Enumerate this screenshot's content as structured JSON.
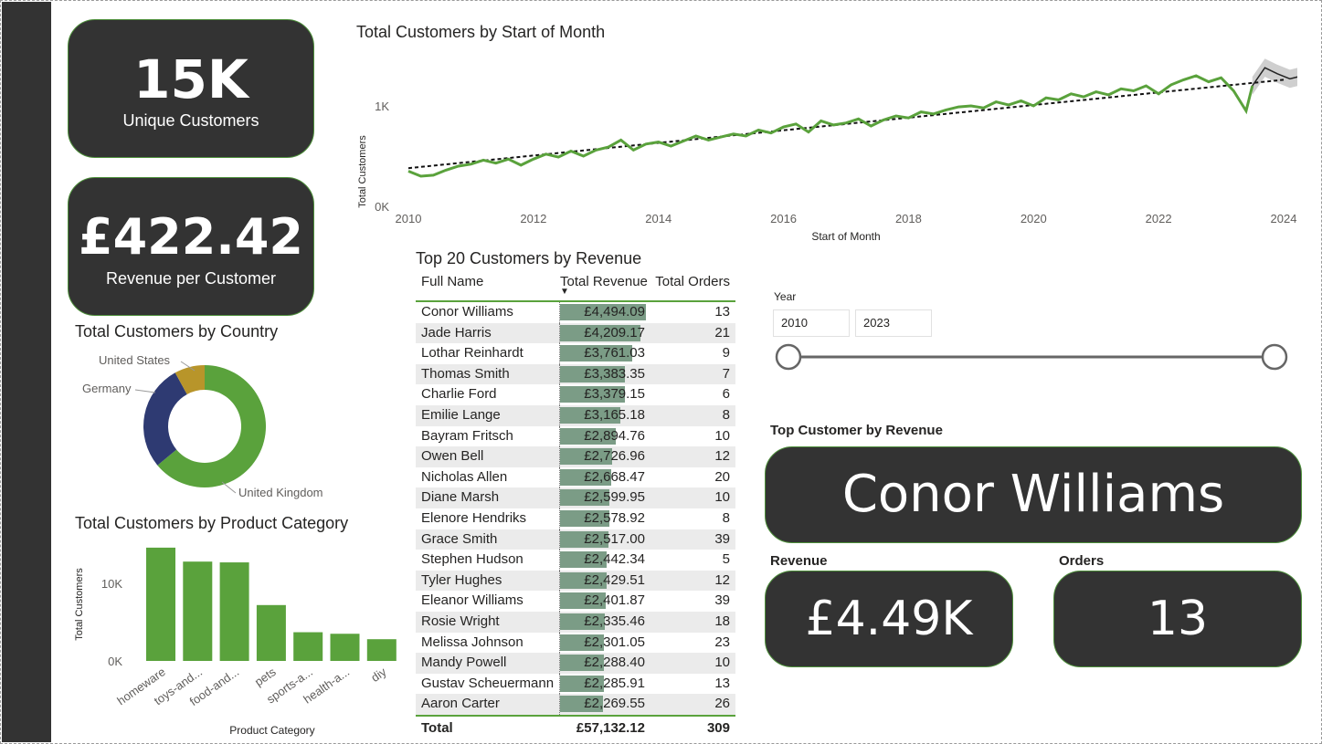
{
  "kpis": {
    "unique_customers": {
      "value": "15K",
      "label": "Unique Customers"
    },
    "revenue_per_customer": {
      "value": "£422.42",
      "label": "Revenue per Customer"
    }
  },
  "line_chart": {
    "title": "Total Customers by Start of Month",
    "ylabel": "Total Customers",
    "xlabel": "Start of Month",
    "yticks": [
      "1K",
      "0K"
    ],
    "xticks": [
      "2010",
      "2012",
      "2014",
      "2016",
      "2018",
      "2020",
      "2022",
      "2024"
    ]
  },
  "donut_chart": {
    "title": "Total Customers by Country",
    "labels": [
      "United States",
      "Germany",
      "United Kingdom"
    ]
  },
  "bar_chart": {
    "title": "Total Customers by Product Category",
    "ylabel": "Total Customers",
    "xlabel": "Product Category",
    "yticks": [
      "10K",
      "0K"
    ],
    "categories": [
      "homeware",
      "toys-and...",
      "food-and...",
      "pets",
      "sports-a...",
      "health-a...",
      "diy"
    ]
  },
  "table": {
    "title": "Top 20 Customers by Revenue",
    "columns": [
      "Full Name",
      "Total Revenue",
      "Total Orders"
    ],
    "rows": [
      {
        "name": "Conor Williams",
        "revenue": "£4,494.09",
        "orders": "13"
      },
      {
        "name": "Jade Harris",
        "revenue": "£4,209.17",
        "orders": "21"
      },
      {
        "name": "Lothar Reinhardt",
        "revenue": "£3,761.03",
        "orders": "9"
      },
      {
        "name": "Thomas Smith",
        "revenue": "£3,383.35",
        "orders": "7"
      },
      {
        "name": "Charlie Ford",
        "revenue": "£3,379.15",
        "orders": "6"
      },
      {
        "name": "Emilie Lange",
        "revenue": "£3,165.18",
        "orders": "8"
      },
      {
        "name": "Bayram Fritsch",
        "revenue": "£2,894.76",
        "orders": "10"
      },
      {
        "name": "Owen Bell",
        "revenue": "£2,726.96",
        "orders": "12"
      },
      {
        "name": "Nicholas Allen",
        "revenue": "£2,668.47",
        "orders": "20"
      },
      {
        "name": "Diane Marsh",
        "revenue": "£2,599.95",
        "orders": "10"
      },
      {
        "name": "Elenore Hendriks",
        "revenue": "£2,578.92",
        "orders": "8"
      },
      {
        "name": "Grace Smith",
        "revenue": "£2,517.00",
        "orders": "39"
      },
      {
        "name": "Stephen Hudson",
        "revenue": "£2,442.34",
        "orders": "5"
      },
      {
        "name": "Tyler Hughes",
        "revenue": "£2,429.51",
        "orders": "12"
      },
      {
        "name": "Eleanor Williams",
        "revenue": "£2,401.87",
        "orders": "39"
      },
      {
        "name": "Rosie Wright",
        "revenue": "£2,335.46",
        "orders": "18"
      },
      {
        "name": "Melissa Johnson",
        "revenue": "£2,301.05",
        "orders": "23"
      },
      {
        "name": "Mandy Powell",
        "revenue": "£2,288.40",
        "orders": "10"
      },
      {
        "name": "Gustav Scheuermann",
        "revenue": "£2,285.91",
        "orders": "13"
      },
      {
        "name": "Aaron Carter",
        "revenue": "£2,269.55",
        "orders": "26"
      }
    ],
    "total": {
      "label": "Total",
      "revenue": "£57,132.12",
      "orders": "309"
    }
  },
  "slicer": {
    "label": "Year",
    "from": "2010",
    "to": "2023"
  },
  "top_customer": {
    "label": "Top Customer by Revenue",
    "name": "Conor Williams",
    "revenue_label": "Revenue",
    "revenue": "£4.49K",
    "orders_label": "Orders",
    "orders": "13"
  },
  "colors": {
    "accent_green": "#5aa23c",
    "card_bg": "#333333",
    "germany": "#2e3a72",
    "united_states": "#b8952a",
    "table_bar": "#7b9c86"
  },
  "chart_data": [
    {
      "type": "line",
      "title": "Total Customers by Start of Month",
      "xlabel": "Start of Month",
      "ylabel": "Total Customers",
      "xlim": [
        2010,
        2024.3
      ],
      "ylim": [
        0,
        1500
      ],
      "series": [
        {
          "values": [
            [
              2010.0,
              350
            ],
            [
              2010.2,
              300
            ],
            [
              2010.4,
              310
            ],
            [
              2010.6,
              360
            ],
            [
              2010.8,
              400
            ],
            [
              2011.0,
              420
            ],
            [
              2011.2,
              460
            ],
            [
              2011.4,
              430
            ],
            [
              2011.6,
              470
            ],
            [
              2011.8,
              410
            ],
            [
              2012.0,
              470
            ],
            [
              2012.2,
              520
            ],
            [
              2012.4,
              490
            ],
            [
              2012.6,
              550
            ],
            [
              2012.8,
              500
            ],
            [
              2013.0,
              560
            ],
            [
              2013.2,
              590
            ],
            [
              2013.4,
              660
            ],
            [
              2013.6,
              560
            ],
            [
              2013.8,
              620
            ],
            [
              2014.0,
              640
            ],
            [
              2014.2,
              600
            ],
            [
              2014.4,
              650
            ],
            [
              2014.6,
              700
            ],
            [
              2014.8,
              660
            ],
            [
              2015.0,
              690
            ],
            [
              2015.2,
              720
            ],
            [
              2015.4,
              700
            ],
            [
              2015.6,
              760
            ],
            [
              2015.8,
              730
            ],
            [
              2016.0,
              790
            ],
            [
              2016.2,
              820
            ],
            [
              2016.4,
              740
            ],
            [
              2016.6,
              850
            ],
            [
              2016.8,
              810
            ],
            [
              2017.0,
              830
            ],
            [
              2017.2,
              870
            ],
            [
              2017.4,
              800
            ],
            [
              2017.6,
              860
            ],
            [
              2017.8,
              900
            ],
            [
              2018.0,
              880
            ],
            [
              2018.2,
              940
            ],
            [
              2018.4,
              920
            ],
            [
              2018.6,
              960
            ],
            [
              2018.8,
              990
            ],
            [
              2019.0,
              1000
            ],
            [
              2019.2,
              980
            ],
            [
              2019.4,
              1040
            ],
            [
              2019.6,
              1010
            ],
            [
              2019.8,
              1050
            ],
            [
              2020.0,
              1000
            ],
            [
              2020.2,
              1080
            ],
            [
              2020.4,
              1060
            ],
            [
              2020.6,
              1120
            ],
            [
              2020.8,
              1090
            ],
            [
              2021.0,
              1140
            ],
            [
              2021.2,
              1110
            ],
            [
              2021.4,
              1170
            ],
            [
              2021.6,
              1150
            ],
            [
              2021.8,
              1200
            ],
            [
              2022.0,
              1120
            ],
            [
              2022.2,
              1210
            ],
            [
              2022.4,
              1260
            ],
            [
              2022.6,
              1300
            ],
            [
              2022.8,
              1240
            ],
            [
              2023.0,
              1280
            ],
            [
              2023.2,
              1150
            ],
            [
              2023.4,
              950
            ],
            [
              2023.5,
              1200
            ]
          ]
        },
        {
          "values": [
            [
              2023.5,
              1200
            ],
            [
              2023.7,
              1380
            ],
            [
              2023.9,
              1320
            ],
            [
              2024.1,
              1270
            ],
            [
              2024.3,
              1300
            ]
          ]
        }
      ],
      "trend": [
        [
          2010,
          380
        ],
        [
          2024,
          1260
        ]
      ]
    },
    {
      "type": "pie",
      "title": "Total Customers by Country",
      "categories": [
        "United Kingdom",
        "Germany",
        "United States"
      ],
      "values": [
        64,
        28,
        8
      ]
    },
    {
      "type": "bar",
      "title": "Total Customers by Product Category",
      "xlabel": "Product Category",
      "ylabel": "Total Customers",
      "categories": [
        "homeware",
        "toys-and...",
        "food-and...",
        "pets",
        "sports-a...",
        "health-a...",
        "diy"
      ],
      "values": [
        14600,
        12800,
        12700,
        7200,
        3700,
        3500,
        2800
      ],
      "ylim": [
        0,
        15000
      ]
    },
    {
      "type": "table",
      "title": "Top 20 Customers by Revenue",
      "columns": [
        "Full Name",
        "Total Revenue",
        "Total Orders"
      ],
      "revenue_values": [
        4494.09,
        4209.17,
        3761.03,
        3383.35,
        3379.15,
        3165.18,
        2894.76,
        2726.96,
        2668.47,
        2599.95,
        2578.92,
        2517.0,
        2442.34,
        2429.51,
        2401.87,
        2335.46,
        2301.05,
        2288.4,
        2285.91,
        2269.55
      ]
    }
  ]
}
